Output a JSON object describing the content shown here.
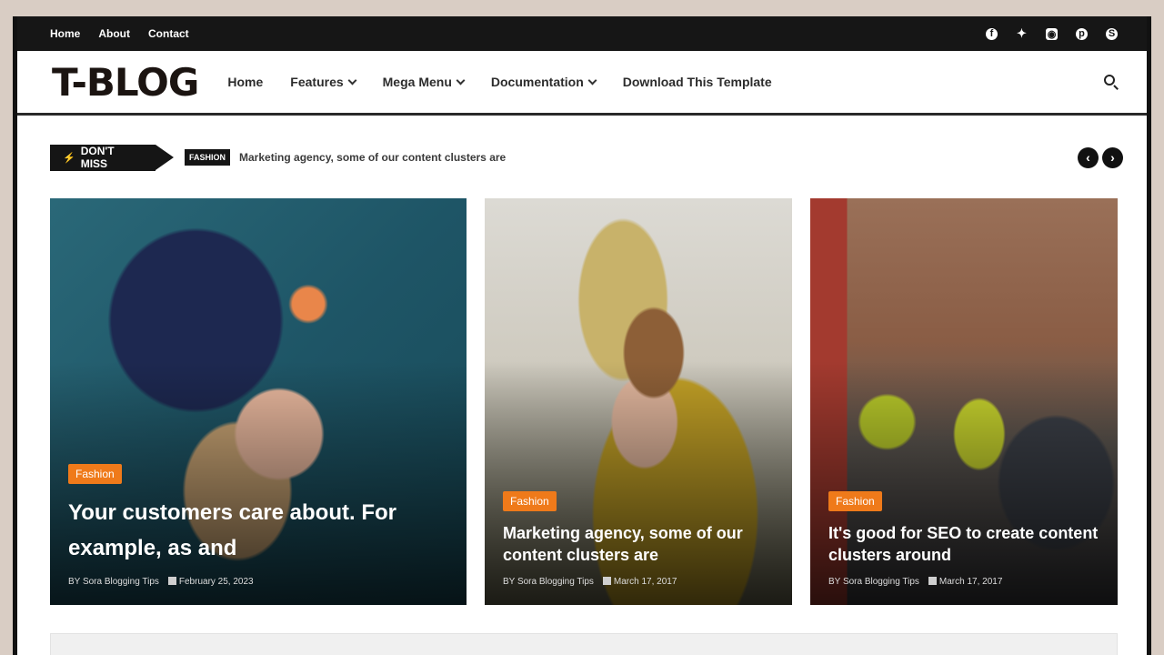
{
  "topbar": {
    "links": [
      "Home",
      "About",
      "Contact"
    ],
    "social_icons": [
      "facebook-icon",
      "twitter-icon",
      "instagram-icon",
      "pinterest-icon",
      "skype-icon"
    ]
  },
  "header": {
    "logo": "T-BLOG",
    "nav": [
      {
        "label": "Home",
        "dropdown": false
      },
      {
        "label": "Features",
        "dropdown": true
      },
      {
        "label": "Mega Menu",
        "dropdown": true
      },
      {
        "label": "Documentation",
        "dropdown": true
      },
      {
        "label": "Download This Template",
        "dropdown": false
      }
    ]
  },
  "ticker": {
    "label": "DON'T MISS",
    "category": "FASHION",
    "text": "Marketing agency, some of our content clusters are"
  },
  "posts": [
    {
      "category": "Fashion",
      "title": "Your customers care about. For example, as and",
      "author": "BY Sora Blogging Tips",
      "date": "February 25, 2023"
    },
    {
      "category": "Fashion",
      "title": "Marketing agency, some of our content clusters are",
      "author": "BY Sora Blogging Tips",
      "date": "March 17, 2017"
    },
    {
      "category": "Fashion",
      "title": "It's good for SEO to create content clusters around",
      "author": "BY Sora Blogging Tips",
      "date": "March 17, 2017"
    }
  ],
  "colors": {
    "accent": "#ef7a1a",
    "dark": "#151515"
  }
}
